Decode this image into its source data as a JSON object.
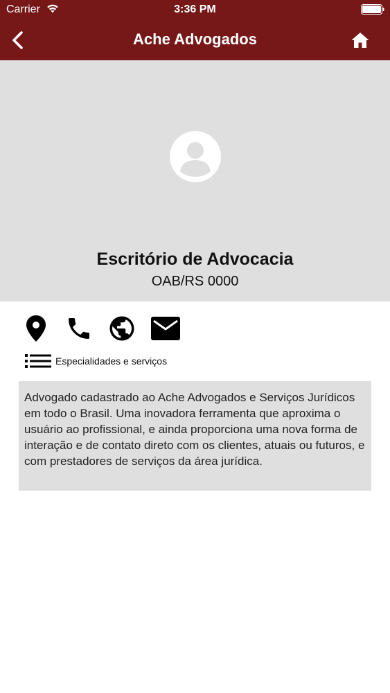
{
  "status_bar": {
    "carrier": "Carrier",
    "time": "3:36 PM"
  },
  "nav": {
    "title": "Ache Advogados",
    "back_icon": "chevron-left-icon",
    "home_icon": "home-icon"
  },
  "profile": {
    "name": "Escritório de Advocacia",
    "oab": "OAB/RS 0000",
    "avatar_icon": "person-icon"
  },
  "actions": [
    {
      "icon": "location-pin-icon"
    },
    {
      "icon": "phone-icon"
    },
    {
      "icon": "globe-icon"
    },
    {
      "icon": "mail-icon"
    }
  ],
  "specialties": {
    "label": "Especialidades e serviços",
    "icon": "list-icon"
  },
  "description": {
    "text": "Advogado cadastrado ao Ache Advogados e Serviços Jurídicos em todo o Brasil. Uma inovadora ferramenta que aproxima o usuário ao profissional, e ainda proporciona uma nova forma de interação e de contato direto com os clientes, atuais ou futuros, e com prestadores de serviços da área jurídica."
  },
  "colors": {
    "brand": "#761818",
    "panel": "#e0dfdf"
  }
}
